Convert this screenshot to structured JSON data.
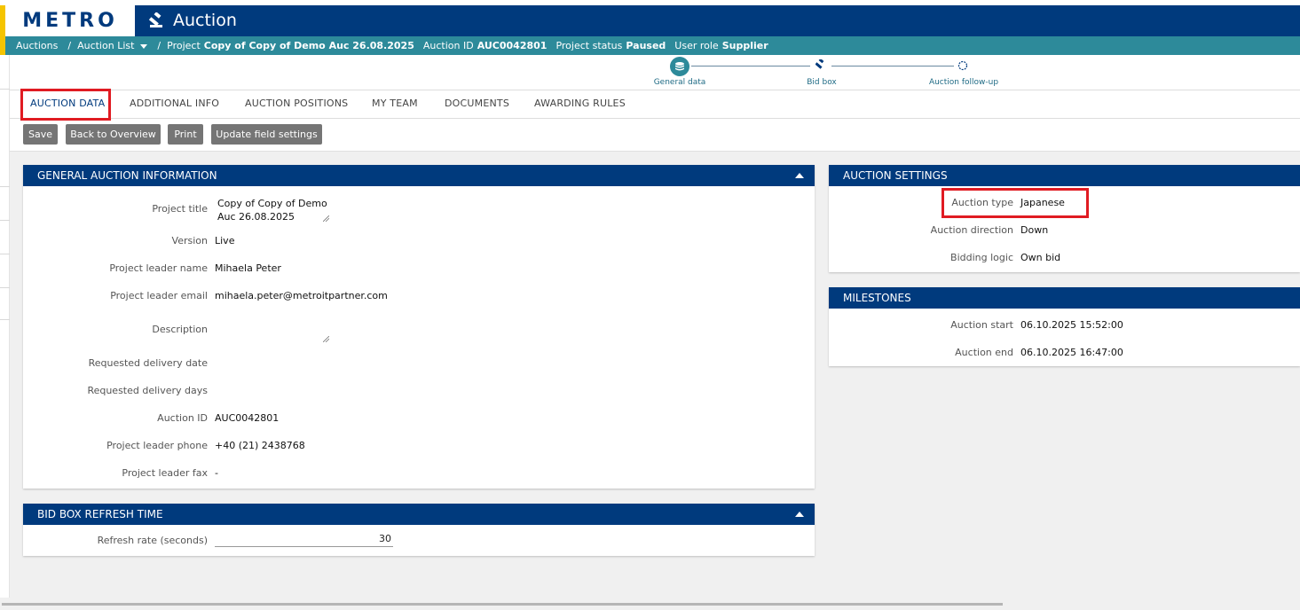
{
  "header": {
    "logo_text": "METRO",
    "app_title": "Auction"
  },
  "breadcrumb": {
    "auctions": "Auctions",
    "auction_list": "Auction List",
    "project_label": "Project",
    "project_value": "Copy of Copy of Demo Auc 26.08.2025",
    "auction_id_label": "Auction ID",
    "auction_id_value": "AUC0042801",
    "status_label": "Project status",
    "status_value": "Paused",
    "role_label": "User role",
    "role_value": "Supplier"
  },
  "stepper": {
    "steps": [
      {
        "label": "General data",
        "state": "active"
      },
      {
        "label": "Bid box",
        "state": "pending"
      },
      {
        "label": "Auction follow-up",
        "state": "pending"
      }
    ]
  },
  "tabs": [
    {
      "label": "AUCTION DATA",
      "active": true
    },
    {
      "label": "ADDITIONAL INFO"
    },
    {
      "label": "AUCTION POSITIONS"
    },
    {
      "label": "MY TEAM"
    },
    {
      "label": "DOCUMENTS"
    },
    {
      "label": "AWARDING RULES"
    }
  ],
  "toolbar": {
    "save": "Save",
    "back": "Back to Overview",
    "print": "Print",
    "update_fields": "Update field settings"
  },
  "general_info": {
    "title": "GENERAL AUCTION INFORMATION",
    "project_title_label": "Project title",
    "project_title_value": "Copy of Copy of Demo Auc 26.08.2025",
    "version_label": "Version",
    "version_value": "Live",
    "leader_name_label": "Project leader name",
    "leader_name_value": "Mihaela Peter",
    "leader_email_label": "Project leader email",
    "leader_email_value": "mihaela.peter@metroitpartner.com",
    "description_label": "Description",
    "description_value": "",
    "delivery_date_label": "Requested delivery date",
    "delivery_days_label": "Requested delivery days",
    "auction_id_label": "Auction ID",
    "auction_id_value": "AUC0042801",
    "leader_phone_label": "Project leader phone",
    "leader_phone_value": "+40 (21) 2438768",
    "leader_fax_label": "Project leader fax",
    "leader_fax_value": "-"
  },
  "bid_box": {
    "title": "BID BOX REFRESH TIME",
    "refresh_label": "Refresh rate (seconds)",
    "refresh_value": "30"
  },
  "auction_settings": {
    "title": "AUCTION SETTINGS",
    "type_label": "Auction type",
    "type_value": "Japanese",
    "direction_label": "Auction direction",
    "direction_value": "Down",
    "logic_label": "Bidding logic",
    "logic_value": "Own bid"
  },
  "milestones": {
    "title": "MILESTONES",
    "start_label": "Auction start",
    "start_value": "06.10.2025 15:52:00",
    "end_label": "Auction end",
    "end_value": "06.10.2025 16:47:00"
  },
  "colors": {
    "brand_navy": "#003a7d",
    "teal": "#2d8a9a",
    "highlight_red": "#e01b22",
    "button_gray": "#757575"
  }
}
